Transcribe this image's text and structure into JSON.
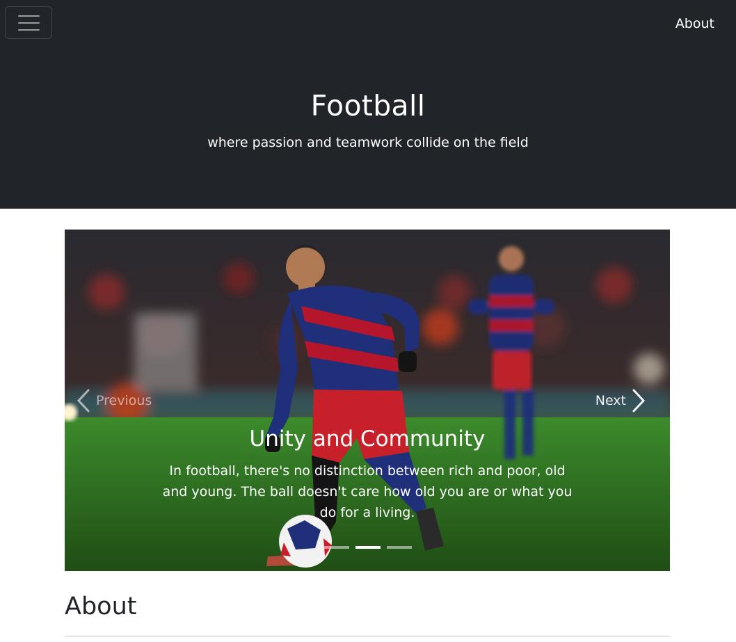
{
  "navbar": {
    "toggler_icon": "hamburger-menu-icon",
    "about_link": "About"
  },
  "hero": {
    "title": "Football",
    "subtitle": "where passion and teamwork collide on the field"
  },
  "carousel": {
    "prev_label": "Previous",
    "next_label": "Next",
    "prev_icon": "chevron-left-icon",
    "next_icon": "chevron-right-icon",
    "active_slide": {
      "title": "Unity and Community",
      "text": "In football, there's no distinction between rich and poor, old and young. The ball doesn't care how old you are or what you do for a living."
    },
    "indicator_count": 3,
    "active_indicator": 2
  },
  "about": {
    "heading": "About"
  },
  "colors": {
    "header_bg": "#212529",
    "pitch_green": "#2f7d22",
    "kit_blue": "#1f2f7a",
    "kit_red": "#b5162b"
  }
}
